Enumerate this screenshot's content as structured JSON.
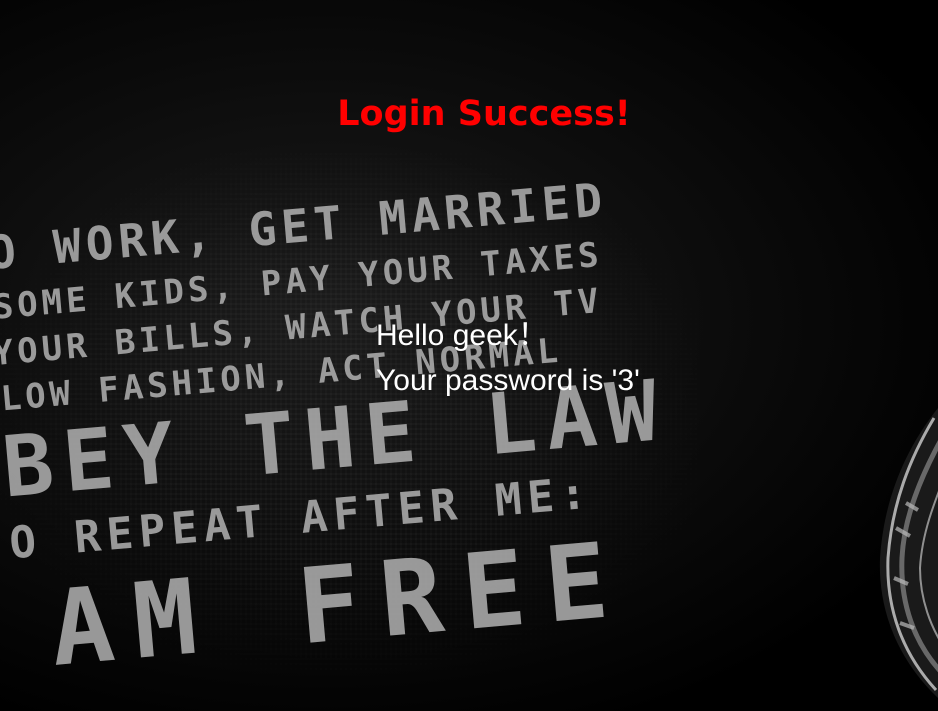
{
  "page": {
    "title": "Login Success!",
    "greeting": "Hello geek！",
    "password_message": "Your password is '3'"
  },
  "background": {
    "lines": [
      "O WORK, GET MARRIED",
      "SOME KIDS, PAY YOUR TAXES",
      "YOUR BILLS, WATCH YOUR TV",
      "LOW FASHION, ACT NORMAL",
      "BEY THE LAW",
      "O REPEAT AFTER ME:",
      "AM FREE"
    ],
    "title_color": "#ff0000",
    "text_color": "#ffffff",
    "background_color": "#000000"
  }
}
